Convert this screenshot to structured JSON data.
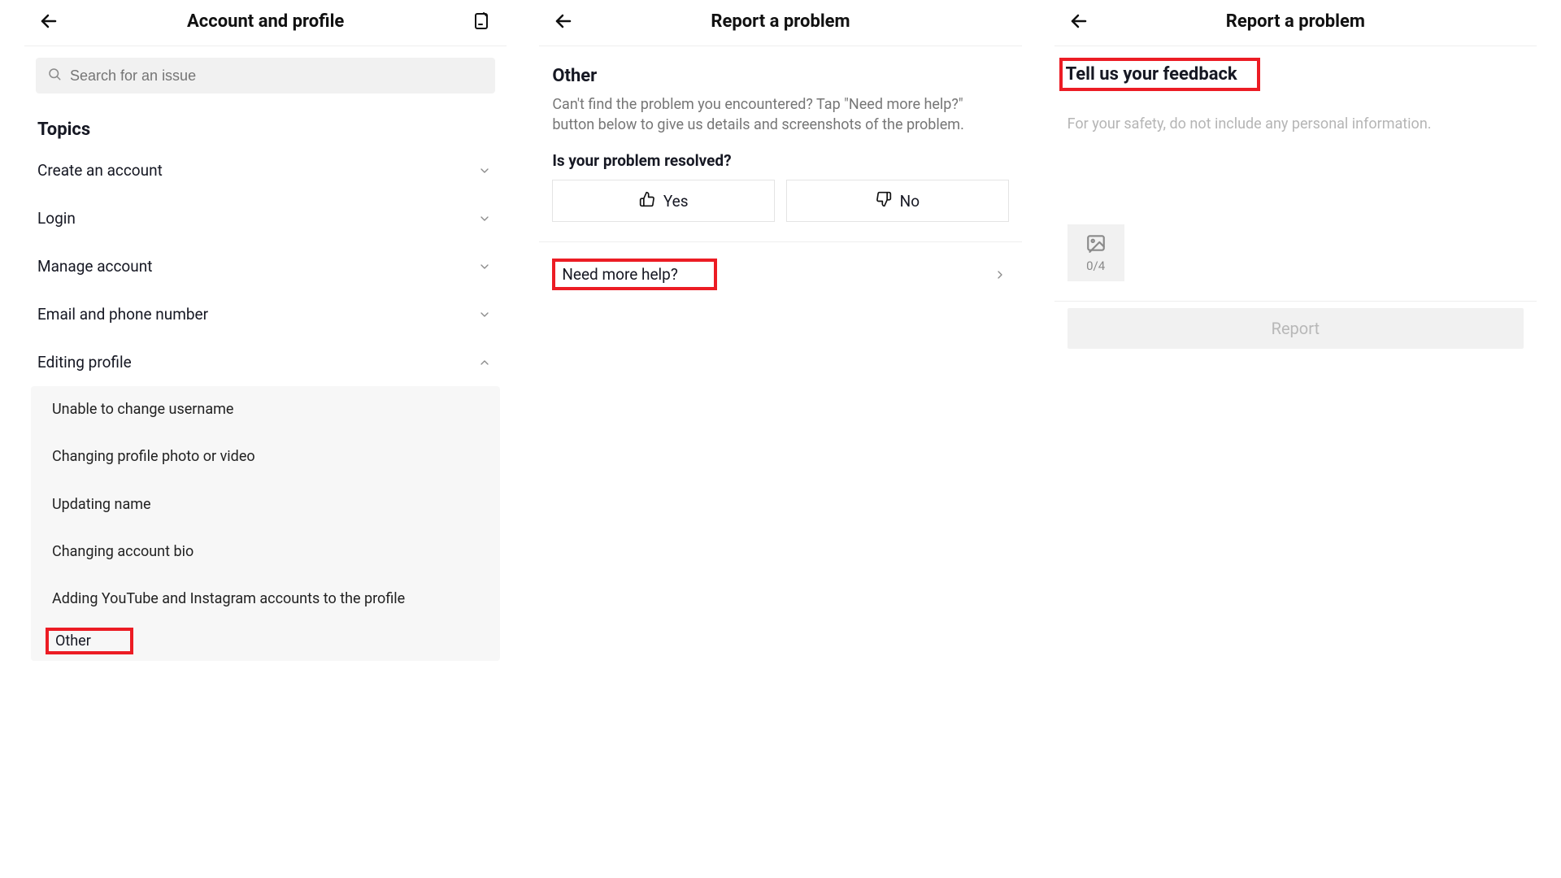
{
  "panel1": {
    "title": "Account and profile",
    "search_placeholder": "Search for an issue",
    "section_title": "Topics",
    "topics": [
      {
        "label": "Create an account",
        "expanded": false
      },
      {
        "label": "Login",
        "expanded": false
      },
      {
        "label": "Manage account",
        "expanded": false
      },
      {
        "label": "Email and phone number",
        "expanded": false
      },
      {
        "label": "Editing profile",
        "expanded": true
      }
    ],
    "editing_profile_sub": [
      "Unable to change username",
      "Changing profile photo or video",
      "Updating name",
      "Changing account bio",
      "Adding YouTube and Instagram accounts to the profile",
      "Other"
    ]
  },
  "panel2": {
    "title": "Report a problem",
    "other_heading": "Other",
    "other_desc": "Can't find the problem you encountered? Tap \"Need more help?\" button below to give us details and screenshots of the problem.",
    "resolve_q": "Is your problem resolved?",
    "yes_label": "Yes",
    "no_label": "No",
    "need_help_label": "Need more help?"
  },
  "panel3": {
    "title": "Report a problem",
    "feedback_heading": "Tell us your feedback",
    "feedback_placeholder": "For your safety, do not include any personal information.",
    "upload_count": "0/4",
    "report_label": "Report"
  }
}
